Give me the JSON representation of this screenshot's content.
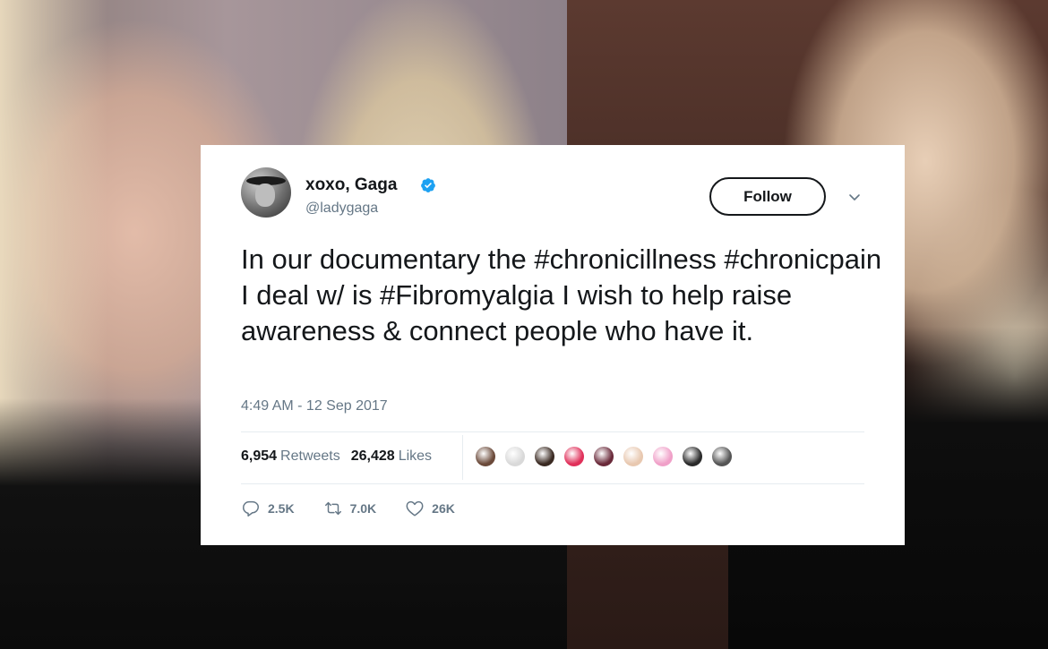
{
  "tweet": {
    "display_name": "xoxo, Gaga",
    "handle": "@ladygaga",
    "follow_label": "Follow",
    "text": "In our documentary the #chronicillness #chronicpain I deal w/ is #Fibromyalgia I wish to help raise awareness & connect people who have it.",
    "timestamp": "4:49 AM - 12 Sep 2017",
    "retweets_count": "6,954",
    "retweets_label": "Retweets",
    "likes_count": "26,428",
    "likes_label": "Likes",
    "replies_short": "2.5K",
    "retweets_short": "7.0K",
    "likes_short": "26K",
    "verified_color": "#1da1f2",
    "liker_colors": [
      "#6b4a3a",
      "#d9d9d9",
      "#3a2a22",
      "#e0305a",
      "#6a2a3a",
      "#e8c8b0",
      "#f0a0c8",
      "#2a2a2a",
      "#555555"
    ]
  },
  "icons": {
    "verified": "verified-badge-icon",
    "caret": "chevron-down-icon",
    "reply": "reply-icon",
    "retweet": "retweet-icon",
    "like": "heart-icon"
  }
}
